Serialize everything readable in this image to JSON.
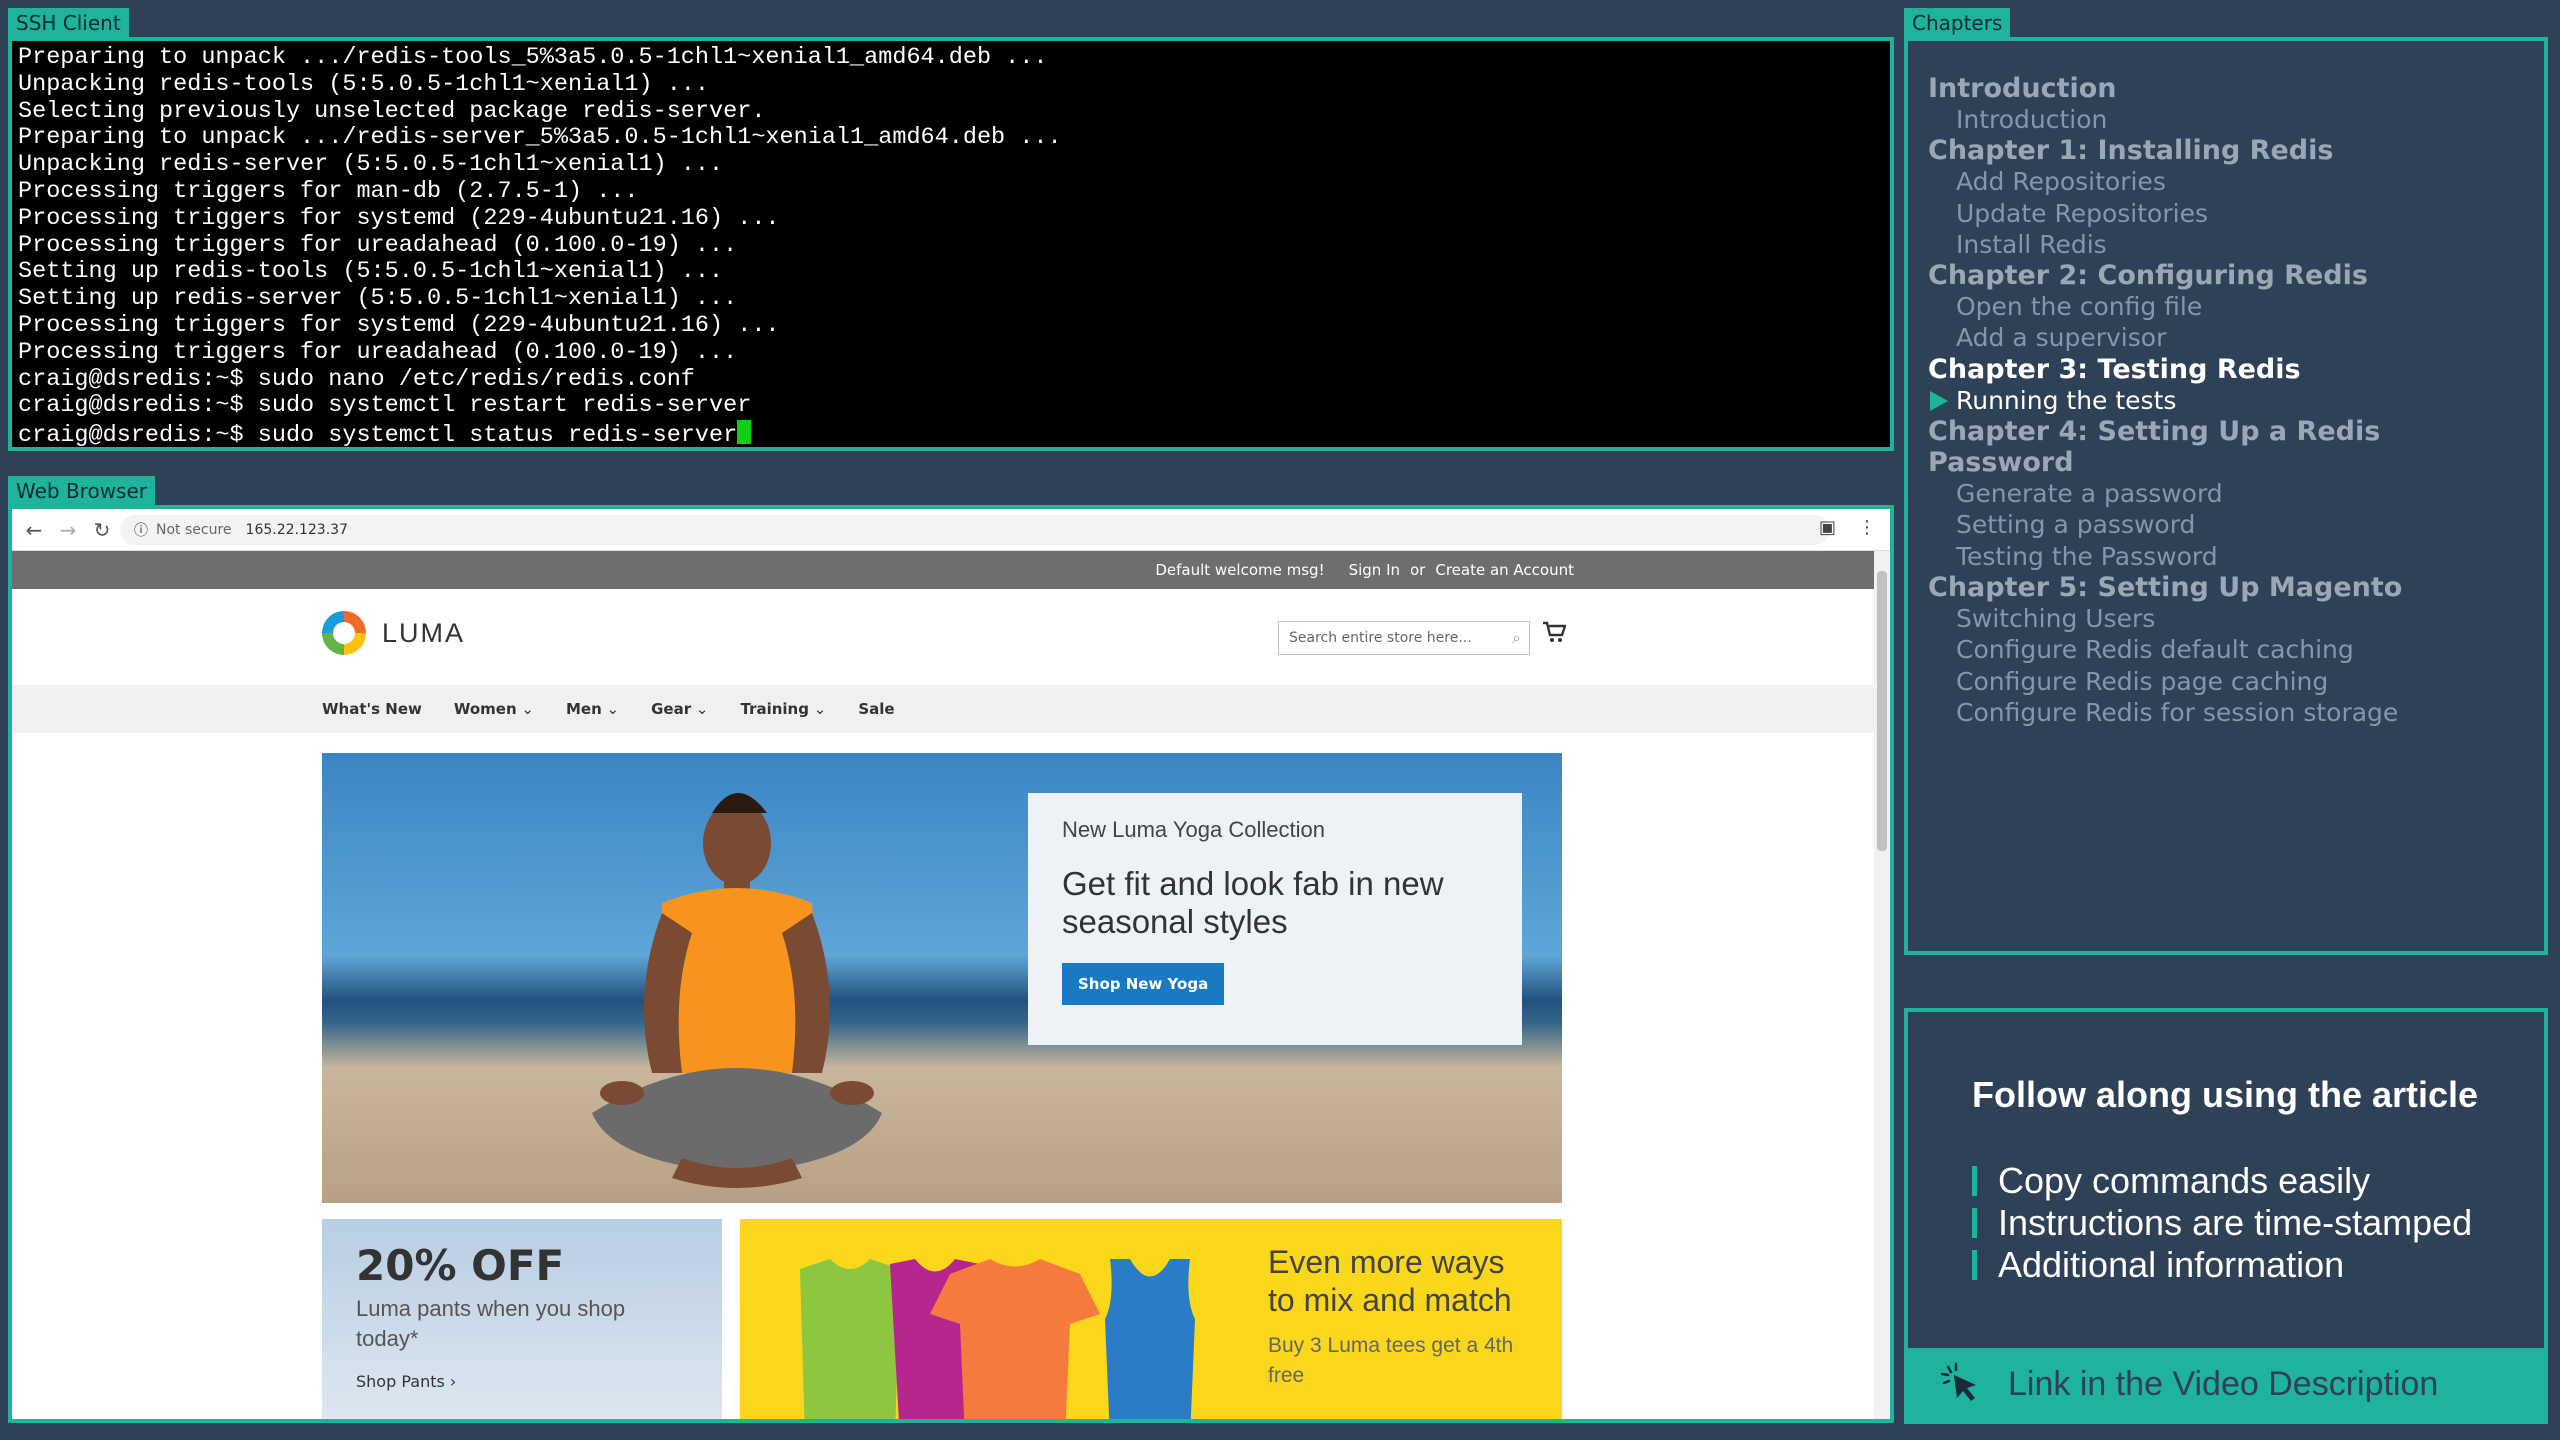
{
  "ssh": {
    "tab_label": "SSH Client",
    "lines": [
      "Preparing to unpack .../redis-tools_5%3a5.0.5-1chl1~xenial1_amd64.deb ...",
      "Unpacking redis-tools (5:5.0.5-1chl1~xenial1) ...",
      "Selecting previously unselected package redis-server.",
      "Preparing to unpack .../redis-server_5%3a5.0.5-1chl1~xenial1_amd64.deb ...",
      "Unpacking redis-server (5:5.0.5-1chl1~xenial1) ...",
      "Processing triggers for man-db (2.7.5-1) ...",
      "Processing triggers for systemd (229-4ubuntu21.16) ...",
      "Processing triggers for ureadahead (0.100.0-19) ...",
      "Setting up redis-tools (5:5.0.5-1chl1~xenial1) ...",
      "Setting up redis-server (5:5.0.5-1chl1~xenial1) ...",
      "Processing triggers for systemd (229-4ubuntu21.16) ...",
      "Processing triggers for ureadahead (0.100.0-19) ...",
      "craig@dsredis:~$ sudo nano /etc/redis/redis.conf",
      "craig@dsredis:~$ sudo systemctl restart redis-server",
      "craig@dsredis:~$ sudo systemctl status redis-server"
    ]
  },
  "browser": {
    "tab_label": "Web Browser",
    "not_secure": "Not secure",
    "url": "165.22.123.37",
    "welcome": "Default welcome msg!",
    "sign_in": "Sign In",
    "or": "or",
    "create_account": "Create an Account",
    "logo": "LUMA",
    "search_placeholder": "Search entire store here...",
    "nav": [
      "What's New",
      "Women",
      "Men",
      "Gear",
      "Training",
      "Sale"
    ],
    "hero": {
      "subtitle": "New Luma Yoga Collection",
      "title": "Get fit and look fab in new seasonal styles",
      "button": "Shop New Yoga"
    },
    "promo1": {
      "title": "20% OFF",
      "subtitle": "Luma pants when you shop today*",
      "link": "Shop Pants ›"
    },
    "promo2": {
      "title": "Even more ways to mix and match",
      "subtitle": "Buy 3 Luma tees get a 4th free"
    }
  },
  "chapters": {
    "tab_label": "Chapters",
    "items": [
      {
        "type": "head",
        "label": "Introduction"
      },
      {
        "type": "item",
        "label": "Introduction"
      },
      {
        "type": "head",
        "label": "Chapter 1: Installing Redis"
      },
      {
        "type": "item",
        "label": "Add Repositories"
      },
      {
        "type": "item",
        "label": "Update Repositories"
      },
      {
        "type": "item",
        "label": "Install Redis"
      },
      {
        "type": "head",
        "label": "Chapter 2: Configuring Redis"
      },
      {
        "type": "item",
        "label": "Open the config file"
      },
      {
        "type": "item",
        "label": "Add a supervisor"
      },
      {
        "type": "head",
        "label": "Chapter 3: Testing Redis",
        "active": true
      },
      {
        "type": "item",
        "label": "Running the tests",
        "active": true
      },
      {
        "type": "head",
        "label": "Chapter 4: Setting Up a Redis Password"
      },
      {
        "type": "item",
        "label": "Generate a password"
      },
      {
        "type": "item",
        "label": "Setting a password"
      },
      {
        "type": "item",
        "label": "Testing the Password"
      },
      {
        "type": "head",
        "label": "Chapter 5: Setting Up Magento"
      },
      {
        "type": "item",
        "label": "Switching Users"
      },
      {
        "type": "item",
        "label": "Configure Redis default caching"
      },
      {
        "type": "item",
        "label": "Configure Redis page caching"
      },
      {
        "type": "item",
        "label": "Configure Redis for session storage"
      }
    ]
  },
  "promo": {
    "title": "Follow along using the article",
    "bullets": [
      "Copy commands easily",
      "Instructions are time-stamped",
      "Additional information"
    ],
    "link": "Link in the Video Description"
  },
  "colors": {
    "accent": "#1fb39a",
    "background": "#2f4157",
    "terminal_bg": "#000000",
    "cursor": "#10d010"
  }
}
